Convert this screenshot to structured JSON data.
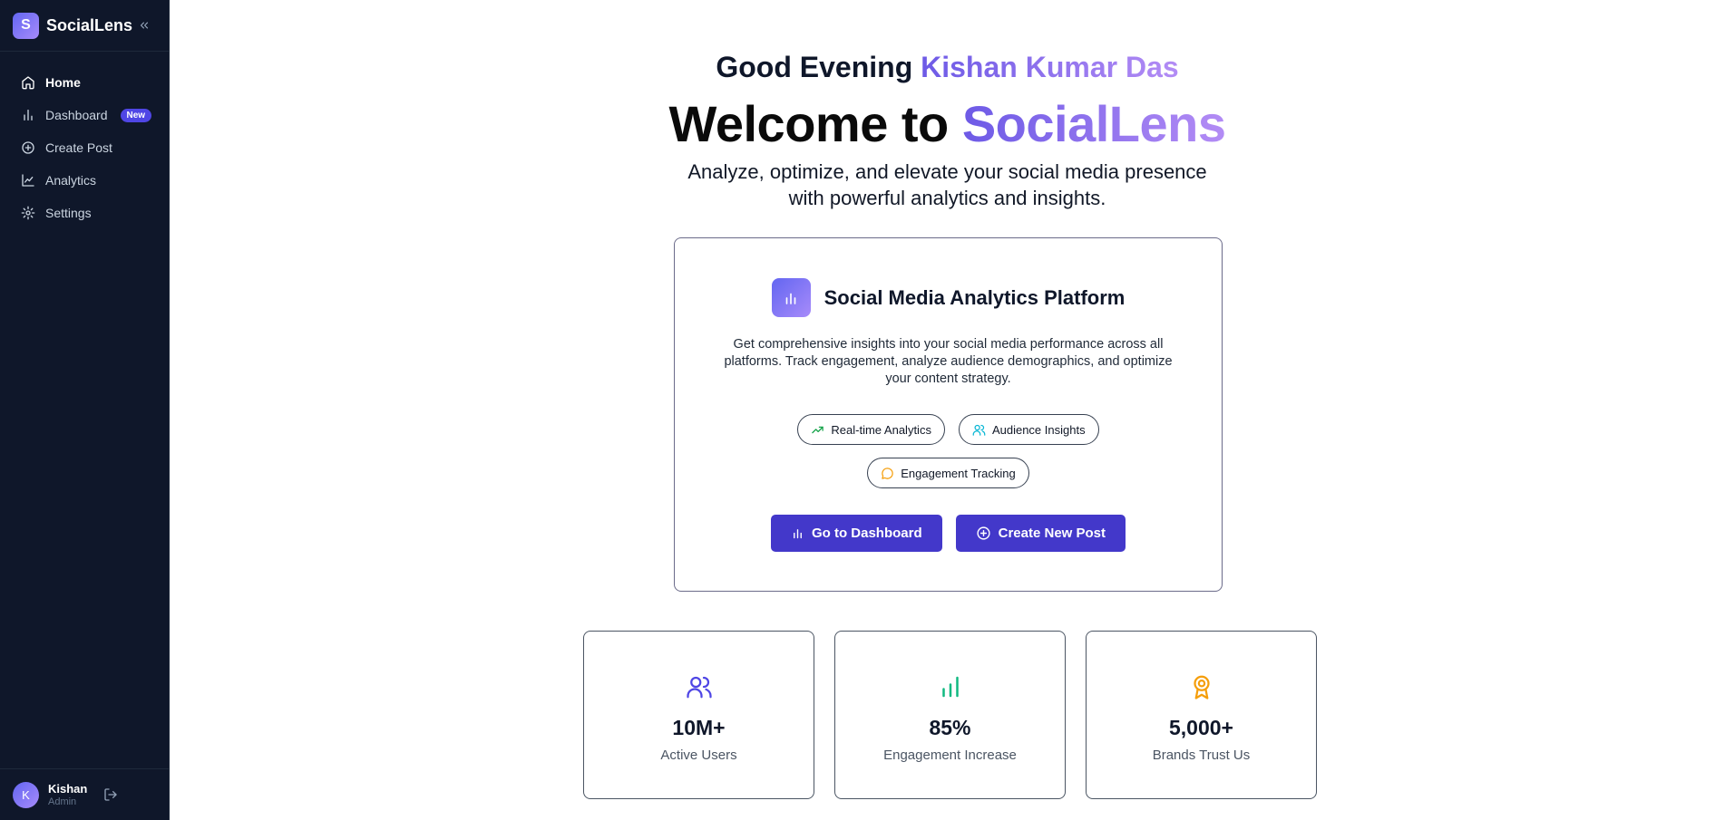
{
  "brand": {
    "logo_letter": "S",
    "name": "SocialLens"
  },
  "sidebar": {
    "items": [
      {
        "label": "Home",
        "icon": "home-icon"
      },
      {
        "label": "Dashboard",
        "icon": "bar-chart-icon",
        "badge": "New"
      },
      {
        "label": "Create Post",
        "icon": "plus-circle-icon"
      },
      {
        "label": "Analytics",
        "icon": "line-chart-icon"
      },
      {
        "label": "Settings",
        "icon": "gear-icon"
      }
    ],
    "active": "Home"
  },
  "user": {
    "initial": "K",
    "name": "Kishan",
    "role": "Admin"
  },
  "hero": {
    "greeting": "Good Evening",
    "user_full_name": "Kishan Kumar Das",
    "welcome_prefix": "Welcome to",
    "welcome_brand": "SocialLens",
    "subtitle_line1": "Analyze, optimize, and elevate your social media presence",
    "subtitle_line2": "with powerful analytics and insights."
  },
  "card": {
    "title": "Social Media Analytics Platform",
    "description": "Get comprehensive insights into your social media performance across all platforms. Track engagement, analyze audience demographics, and optimize your content strategy.",
    "features": [
      {
        "label": "Real-time Analytics",
        "icon": "trending-up-icon",
        "color": "#16a34a"
      },
      {
        "label": "Audience Insights",
        "icon": "users-icon",
        "color": "#06b6d4"
      },
      {
        "label": "Engagement Tracking",
        "icon": "message-circle-icon",
        "color": "#f59e0b"
      }
    ],
    "buttons": {
      "dashboard": "Go to Dashboard",
      "create_post": "Create New Post"
    }
  },
  "stats": [
    {
      "value": "10M+",
      "label": "Active Users",
      "icon": "users-icon",
      "color": "#4f46e5"
    },
    {
      "value": "85%",
      "label": "Engagement Increase",
      "icon": "bar-chart-icon",
      "color": "#10b981"
    },
    {
      "value": "5,000+",
      "label": "Brands Trust Us",
      "icon": "award-icon",
      "color": "#f59e0b"
    }
  ],
  "colors": {
    "sidebar_bg": "#0f172a",
    "primary": "#4338ca",
    "gradient_start": "#6d5ae6",
    "gradient_end": "#b38cf5"
  }
}
